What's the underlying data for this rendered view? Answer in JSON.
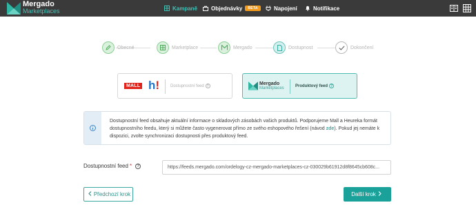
{
  "brand": {
    "name": "Mergado",
    "subtitle": "Marketplaces",
    "colors": {
      "accent": "#1aa19a",
      "topbar": "#3a3a3a",
      "beta": "#f59b1c"
    }
  },
  "nav": {
    "items": [
      {
        "label": "Kampaně",
        "icon": "grid-icon",
        "active": true
      },
      {
        "label": "Objednávky",
        "icon": "bag-icon",
        "badge": "BETA"
      },
      {
        "label": "Napojení",
        "icon": "plug-icon"
      },
      {
        "label": "Notifikace",
        "icon": "bell-icon"
      }
    ],
    "right_icons": [
      "book-icon",
      "grid-menu-icon"
    ]
  },
  "stepper": {
    "steps": [
      {
        "label": "Obecné",
        "state": "done"
      },
      {
        "label": "Marketplace",
        "state": "done"
      },
      {
        "label": "Mergado",
        "state": "done"
      },
      {
        "label": "Dostupnost",
        "state": "active"
      },
      {
        "label": "Dokončení",
        "state": "todo"
      }
    ]
  },
  "feed_options": {
    "left": {
      "mall": "MALL",
      "heureka_h": "h",
      "heureka_bang": "!",
      "label": "Dostupnostní feed",
      "selected": false
    },
    "right": {
      "logo_line1": "Mergado",
      "logo_line2": "Marketplaces",
      "label": "Produktový feed",
      "selected": true
    }
  },
  "info": {
    "text_before": "Dostupnostní feed obsahuje aktuální informace o skladových zásobách vašich produktů. Podporujeme Mall a Heureka formát dostupnostního feedu, který si můžete často vygenerovat přímo ze svého eshopového řešení (návod ",
    "link": "zde",
    "text_after": "). Pokud jej nemáte k dispozici, zvolte synchronizaci dostupnosti přes produktový feed."
  },
  "feed_url": {
    "label": "Dostupnostní feed",
    "required_mark": "*",
    "value": "https://feeds.mergado.com/ordelogy-cz-mergado-marketplaces-cz-030029b61912d8f8645cb608c..."
  },
  "buttons": {
    "prev": "Předchozí krok",
    "next": "Další krok"
  }
}
